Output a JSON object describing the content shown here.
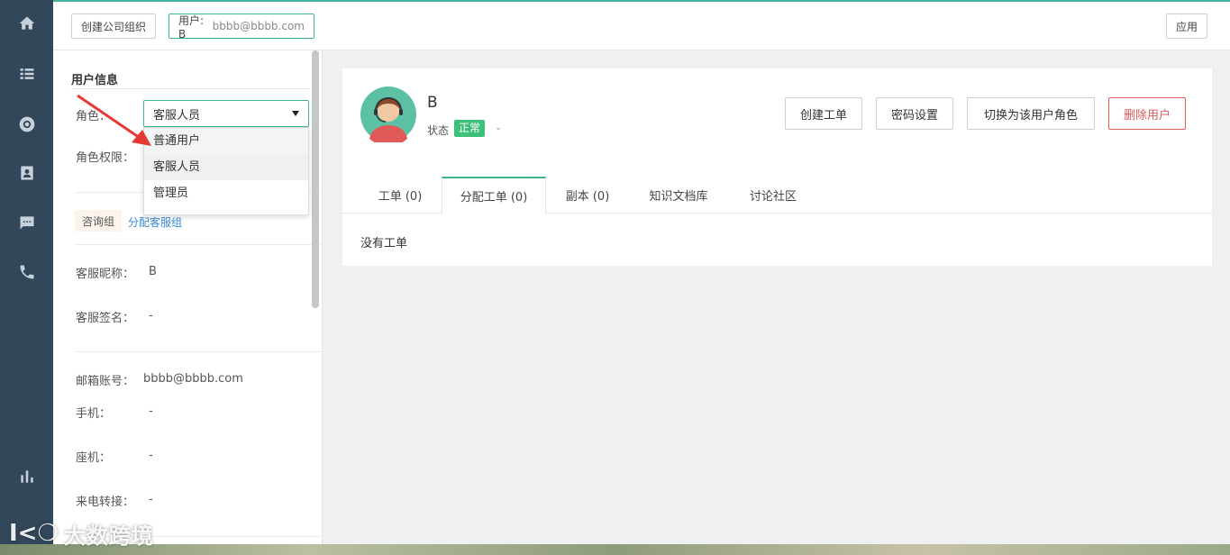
{
  "nav": {
    "items": [
      {
        "name": "home-icon"
      },
      {
        "name": "list-icon"
      },
      {
        "name": "support-icon"
      },
      {
        "name": "contact-card-icon"
      },
      {
        "name": "chat-icon"
      },
      {
        "name": "phone-icon"
      },
      {
        "name": "bar-chart-icon"
      }
    ]
  },
  "topbar": {
    "create_org_label": "创建公司组织",
    "user_tag_prefix": "用户: B",
    "user_tag_email": "bbbb@bbbb.com",
    "apply_label": "应用"
  },
  "left": {
    "section_title": "用户信息",
    "role_label": "角色：",
    "role_value": "客服人员",
    "role_options": [
      "普通用户",
      "客服人员",
      "管理员"
    ],
    "permission_label": "角色权限：",
    "group_tag": "咨询组",
    "assign_group_link": "分配客服组",
    "nickname_label": "客服昵称：",
    "nickname_value": "B",
    "signature_label": "客服签名：",
    "signature_value": "-",
    "email_label": "邮箱账号：",
    "email_value": "bbbb@bbbb.com",
    "mobile_label": "手机：",
    "mobile_value": "-",
    "landline_label": "座机：",
    "landline_value": "-",
    "forward_label": "来电转接：",
    "forward_value": "-"
  },
  "profile": {
    "name": "B",
    "status_label": "状态",
    "status_value": "正常",
    "actions": {
      "create_ticket": "创建工单",
      "password": "密码设置",
      "switch_role": "切换为该用户角色",
      "delete_user": "删除用户"
    },
    "tabs": [
      "工单 (0)",
      "分配工单 (0)",
      "副本 (0)",
      "知识文档库",
      "讨论社区"
    ],
    "active_tab": 1,
    "empty_text": "没有工单"
  },
  "watermark": {
    "logo": "I<❍",
    "text": "大数跨境"
  },
  "colors": {
    "accent": "#3fb28f",
    "nav_bg": "#33475b",
    "danger": "#e05b5b",
    "status_green": "#3ec07a",
    "link": "#3a8bd6"
  }
}
